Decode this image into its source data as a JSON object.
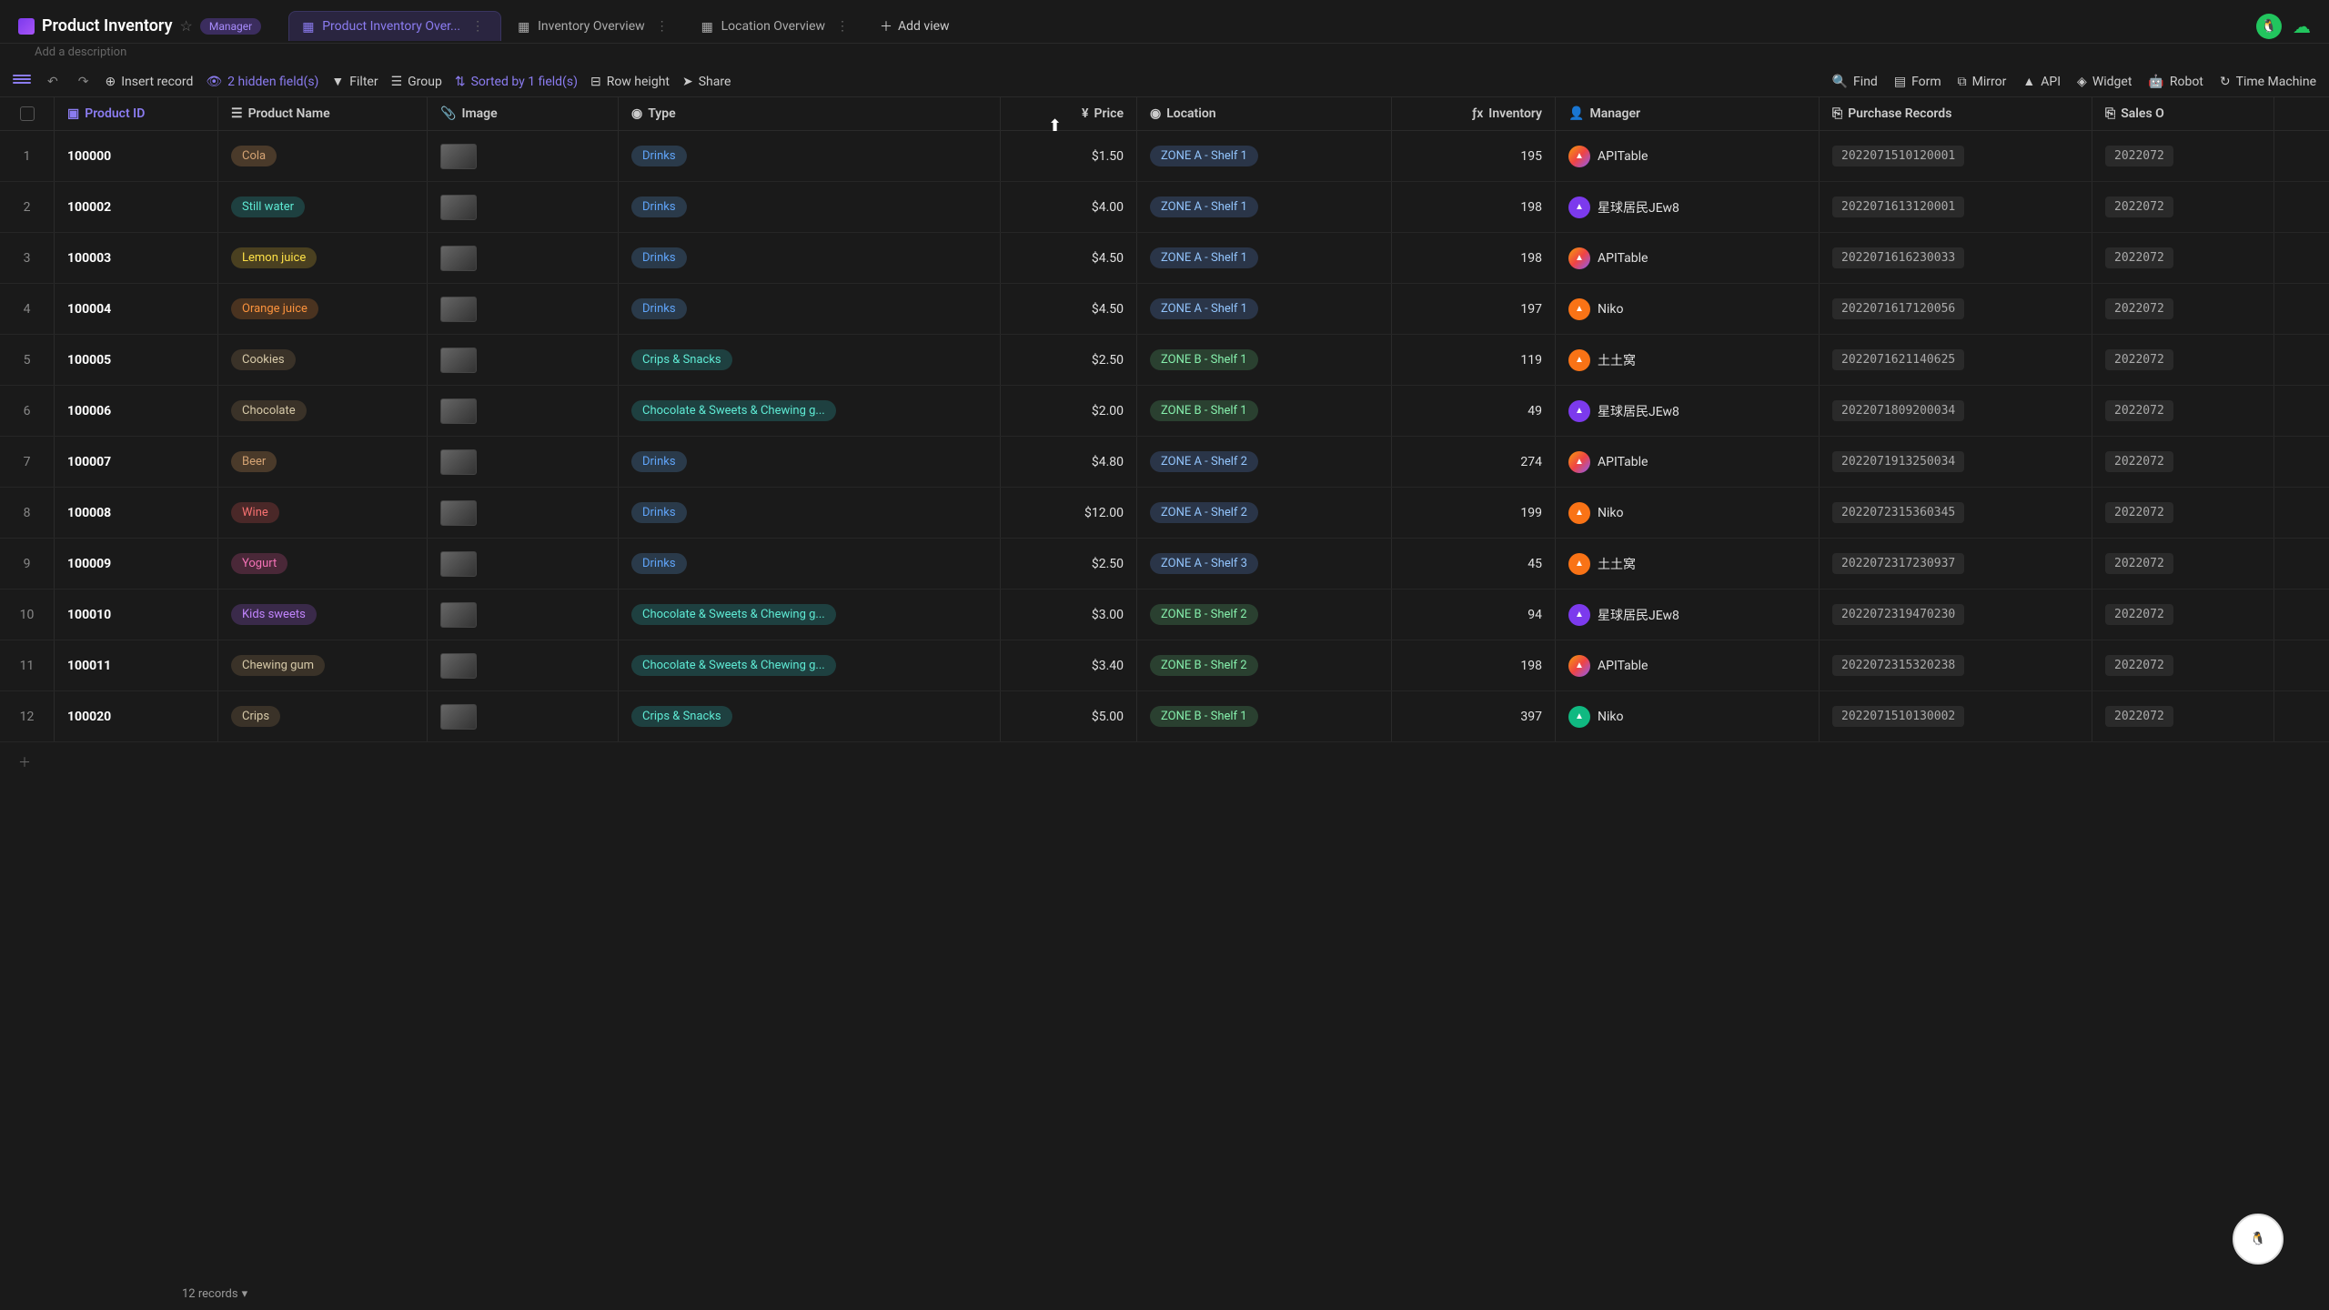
{
  "header": {
    "title": "Product Inventory",
    "role_badge": "Manager",
    "description_placeholder": "Add a description"
  },
  "tabs": [
    {
      "label": "Product Inventory Over...",
      "active": true,
      "icon": "grid"
    },
    {
      "label": "Inventory Overview",
      "active": false,
      "icon": "dashboard"
    },
    {
      "label": "Location Overview",
      "active": false,
      "icon": "columns"
    }
  ],
  "add_view_label": "Add view",
  "toolbar": {
    "insert_record": "Insert record",
    "hidden_fields": "2 hidden field(s)",
    "filter": "Filter",
    "group": "Group",
    "sorted": "Sorted by 1 field(s)",
    "row_height": "Row height",
    "share": "Share",
    "find": "Find",
    "form": "Form",
    "mirror": "Mirror",
    "api": "API",
    "widget": "Widget",
    "robot": "Robot",
    "time_machine": "Time Machine"
  },
  "columns": {
    "product_id": "Product ID",
    "product_name": "Product Name",
    "image": "Image",
    "type": "Type",
    "price": "Price",
    "location": "Location",
    "inventory": "Inventory",
    "manager": "Manager",
    "purchase_records": "Purchase Records",
    "sales_o": "Sales O"
  },
  "rows": [
    {
      "n": 1,
      "id": "100000",
      "name": "Cola",
      "name_cls": "tag-brown",
      "type": "Drinks",
      "type_cls": "tag-blue",
      "price": "$1.50",
      "loc": "ZONE A - Shelf 1",
      "loc_cls": "loc-a",
      "inv": "195",
      "mgr": "APITable",
      "mgr_cls": "mgr0",
      "pr": "2022071510120001",
      "so": "2022072"
    },
    {
      "n": 2,
      "id": "100002",
      "name": "Still water",
      "name_cls": "tag-teal",
      "type": "Drinks",
      "type_cls": "tag-blue",
      "price": "$4.00",
      "loc": "ZONE A - Shelf 1",
      "loc_cls": "loc-a",
      "inv": "198",
      "mgr": "星球居民JEw8",
      "mgr_cls": "mgr1",
      "pr": "2022071613120001",
      "so": "2022072"
    },
    {
      "n": 3,
      "id": "100003",
      "name": "Lemon juice",
      "name_cls": "tag-yellow",
      "type": "Drinks",
      "type_cls": "tag-blue",
      "price": "$4.50",
      "loc": "ZONE A - Shelf 1",
      "loc_cls": "loc-a",
      "inv": "198",
      "mgr": "APITable",
      "mgr_cls": "mgr0",
      "pr": "2022071616230033",
      "so": "2022072"
    },
    {
      "n": 4,
      "id": "100004",
      "name": "Orange juice",
      "name_cls": "tag-orange",
      "type": "Drinks",
      "type_cls": "tag-blue",
      "price": "$4.50",
      "loc": "ZONE A - Shelf 1",
      "loc_cls": "loc-a",
      "inv": "197",
      "mgr": "Niko",
      "mgr_cls": "mgr2",
      "pr": "2022071617120056",
      "so": "2022072"
    },
    {
      "n": 5,
      "id": "100005",
      "name": "Cookies",
      "name_cls": "tag-tan",
      "type": "Crips & Snacks",
      "type_cls": "tag-teal",
      "price": "$2.50",
      "loc": "ZONE B - Shelf 1",
      "loc_cls": "loc-b",
      "inv": "119",
      "mgr": "土土窝",
      "mgr_cls": "mgr2",
      "pr": "2022071621140625",
      "so": "2022072"
    },
    {
      "n": 6,
      "id": "100006",
      "name": "Chocolate",
      "name_cls": "tag-tan",
      "type": "Chocolate & Sweets & Chewing g...",
      "type_cls": "tag-teal",
      "price": "$2.00",
      "loc": "ZONE B - Shelf 1",
      "loc_cls": "loc-b",
      "inv": "49",
      "mgr": "星球居民JEw8",
      "mgr_cls": "mgr1",
      "pr": "2022071809200034",
      "so": "2022072"
    },
    {
      "n": 7,
      "id": "100007",
      "name": "Beer",
      "name_cls": "tag-brown",
      "type": "Drinks",
      "type_cls": "tag-blue",
      "price": "$4.80",
      "loc": "ZONE A - Shelf 2",
      "loc_cls": "loc-a",
      "inv": "274",
      "mgr": "APITable",
      "mgr_cls": "mgr0",
      "pr": "2022071913250034",
      "so": "2022072"
    },
    {
      "n": 8,
      "id": "100008",
      "name": "Wine",
      "name_cls": "tag-red",
      "type": "Drinks",
      "type_cls": "tag-blue",
      "price": "$12.00",
      "loc": "ZONE A - Shelf 2",
      "loc_cls": "loc-a",
      "inv": "199",
      "mgr": "Niko",
      "mgr_cls": "mgr2",
      "pr": "2022072315360345",
      "so": "2022072"
    },
    {
      "n": 9,
      "id": "100009",
      "name": "Yogurt",
      "name_cls": "tag-pink",
      "type": "Drinks",
      "type_cls": "tag-blue",
      "price": "$2.50",
      "loc": "ZONE A - Shelf 3",
      "loc_cls": "loc-a",
      "inv": "45",
      "mgr": "土土窝",
      "mgr_cls": "mgr2",
      "pr": "2022072317230937",
      "so": "2022072"
    },
    {
      "n": 10,
      "id": "100010",
      "name": "Kids sweets",
      "name_cls": "tag-purple",
      "type": "Chocolate & Sweets & Chewing g...",
      "type_cls": "tag-teal",
      "price": "$3.00",
      "loc": "ZONE B - Shelf 2",
      "loc_cls": "loc-b",
      "inv": "94",
      "mgr": "星球居民JEw8",
      "mgr_cls": "mgr1",
      "pr": "2022072319470230",
      "so": "2022072"
    },
    {
      "n": 11,
      "id": "100011",
      "name": "Chewing gum",
      "name_cls": "tag-tan",
      "type": "Chocolate & Sweets & Chewing g...",
      "type_cls": "tag-teal",
      "price": "$3.40",
      "loc": "ZONE B - Shelf 2",
      "loc_cls": "loc-b",
      "inv": "198",
      "mgr": "APITable",
      "mgr_cls": "mgr0",
      "pr": "2022072315320238",
      "so": "2022072"
    },
    {
      "n": 12,
      "id": "100020",
      "name": "Crips",
      "name_cls": "tag-tan",
      "type": "Crips & Snacks",
      "type_cls": "tag-teal",
      "price": "$5.00",
      "loc": "ZONE B - Shelf 1",
      "loc_cls": "loc-b",
      "inv": "397",
      "mgr": "Niko",
      "mgr_cls": "mgr3",
      "pr": "2022071510130002",
      "so": "2022072"
    }
  ],
  "footer": {
    "records": "12 records",
    "caret": "▾"
  }
}
